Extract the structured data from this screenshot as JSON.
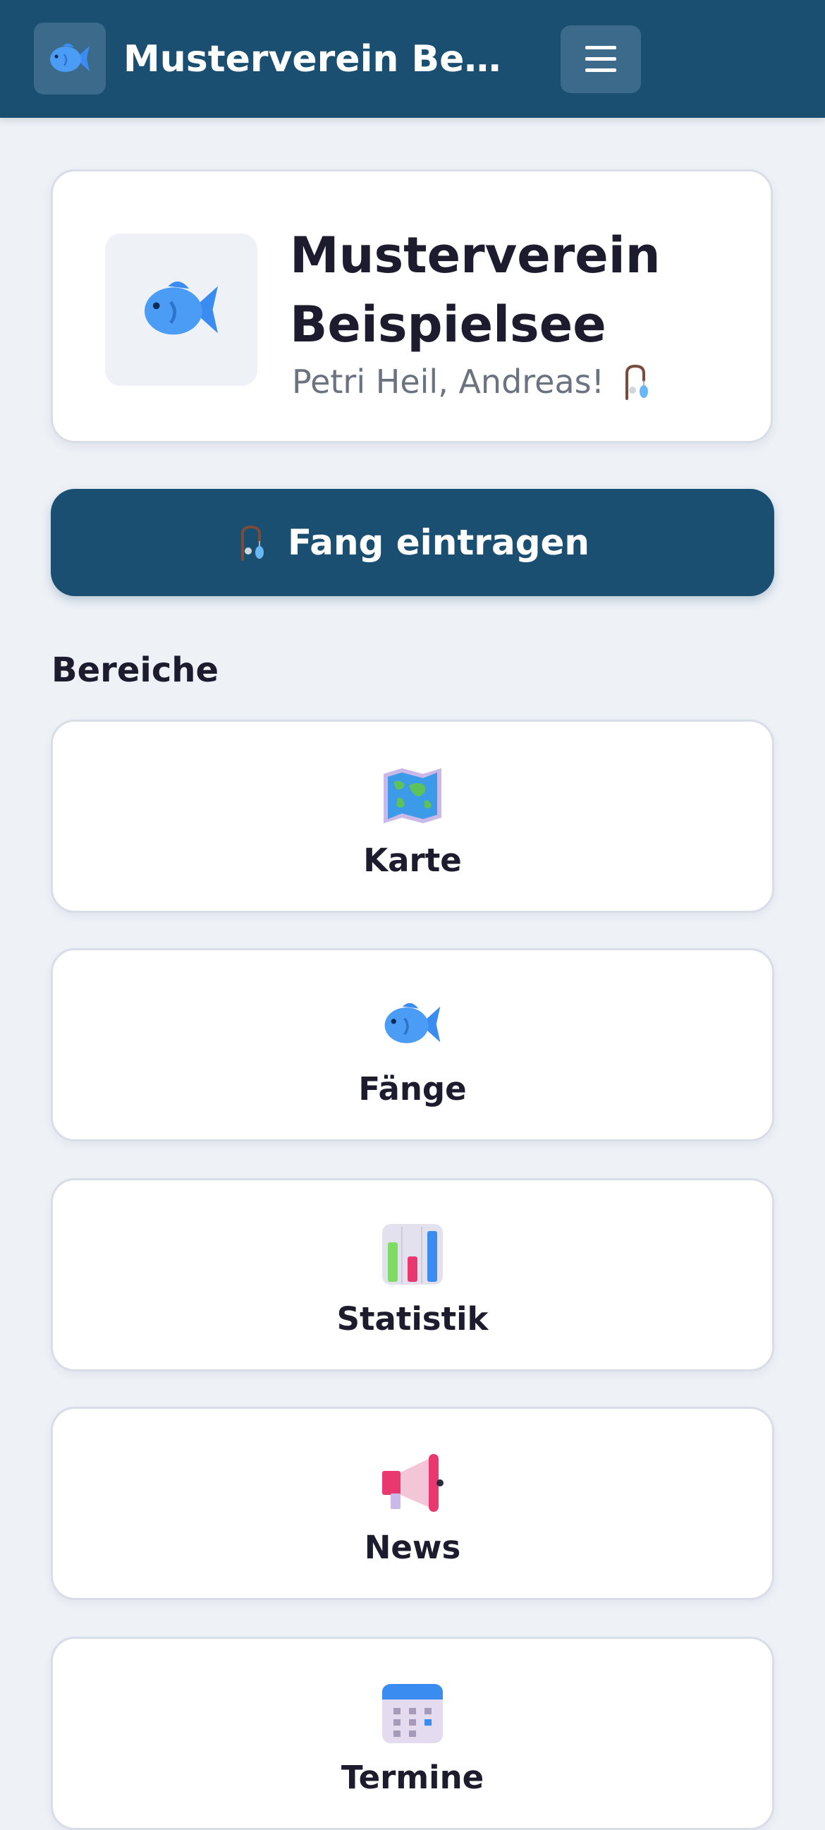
{
  "header": {
    "app_title": "Musterverein Beispi...",
    "logo_icon": "fish-icon",
    "menu_icon": "hamburger-menu-icon"
  },
  "club_card": {
    "name": "Musterverein Beispielsee",
    "greeting": "Petri Heil, Andreas!",
    "logo_icon": "fish-icon",
    "greeting_icon": "fishing-rod-icon"
  },
  "cta": {
    "label": "Fang eintragen",
    "icon": "fishing-rod-icon"
  },
  "section": {
    "title": "Bereiche"
  },
  "tiles": [
    {
      "label": "Karte",
      "icon": "world-map-icon"
    },
    {
      "label": "Fänge",
      "icon": "fish-icon"
    },
    {
      "label": "Statistik",
      "icon": "bar-chart-icon"
    },
    {
      "label": "News",
      "icon": "megaphone-icon"
    },
    {
      "label": "Termine",
      "icon": "calendar-icon"
    }
  ],
  "colors": {
    "primary": "#1b4f72",
    "background": "#eef2f7",
    "card": "#ffffff",
    "muted_text": "#6b7280"
  }
}
